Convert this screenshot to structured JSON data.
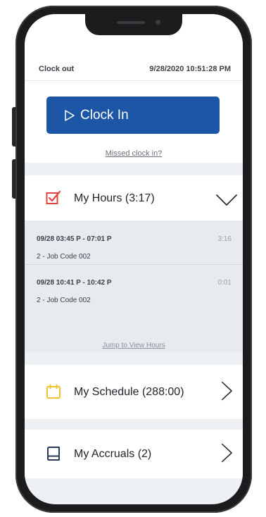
{
  "status": {
    "label": "Clock out",
    "datetime": "9/28/2020 10:51:28 PM"
  },
  "clock": {
    "button_label": "Clock In",
    "missed_link": "Missed clock in?"
  },
  "hours": {
    "title": "My Hours (3:17)",
    "entries": [
      {
        "time": "09/28 03:45 P - 07:01 P",
        "code": "2 - Job Code 002",
        "duration": "3:16"
      },
      {
        "time": "09/28 10:41 P - 10:42 P",
        "code": "2 - Job Code 002",
        "duration": "0:01"
      }
    ],
    "jump_link": "Jump to View Hours"
  },
  "schedule": {
    "title": "My Schedule (288:00)"
  },
  "accruals": {
    "title": "My Accruals (2)"
  },
  "colors": {
    "accent": "#1d56a6",
    "hours_icon": "#e2453c",
    "schedule_icon": "#f2c230",
    "accruals_icon": "#2a3a5c"
  },
  "icons": {
    "clock_in": "play-outline-icon",
    "hours": "checkbox-icon",
    "schedule": "calendar-icon",
    "accruals": "book-icon",
    "hours_toggle": "chevron-down-icon",
    "schedule_toggle": "chevron-right-icon",
    "accruals_toggle": "chevron-right-icon"
  }
}
